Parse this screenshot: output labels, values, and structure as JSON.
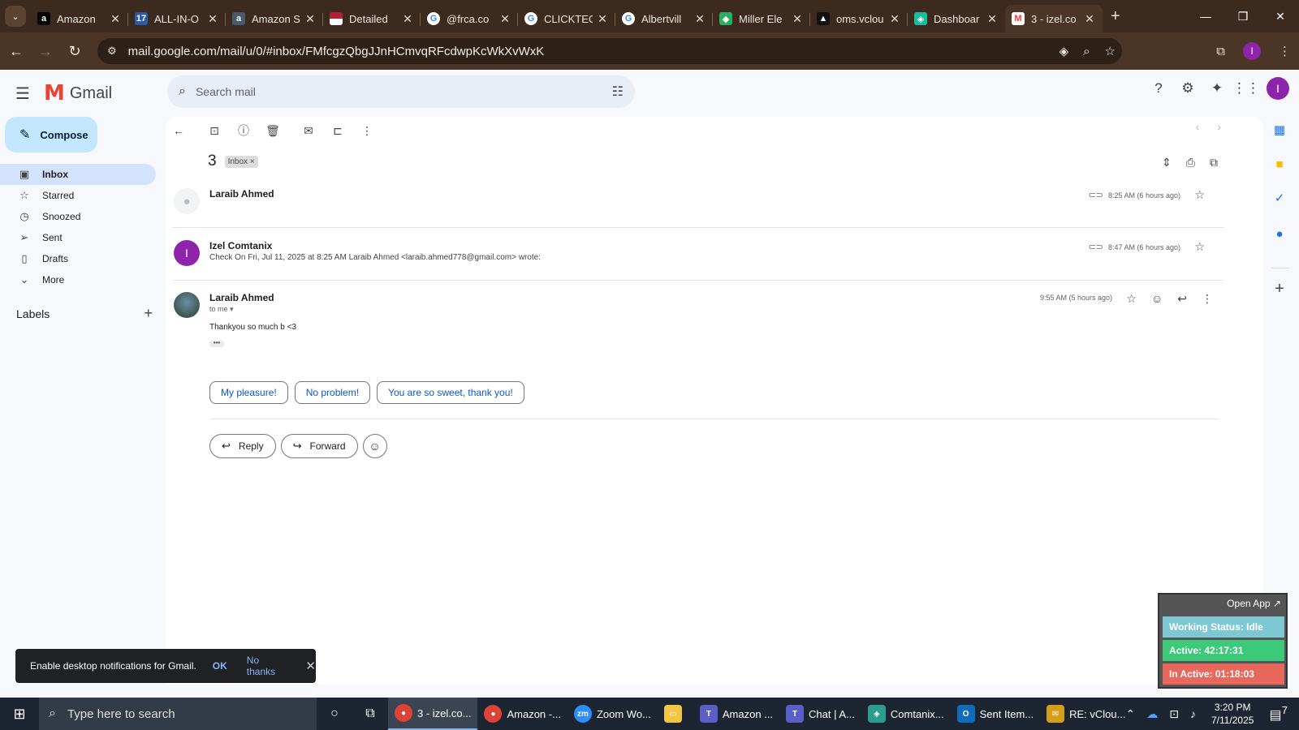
{
  "browser": {
    "tabs": [
      {
        "title": "Amazon",
        "icon": "amazon-icon",
        "color": "#000000"
      },
      {
        "title": "ALL-IN-O",
        "icon": "seventeen-track-icon",
        "color": "#2b5aa8"
      },
      {
        "title": "Amazon S",
        "icon": "amazon-seller-icon",
        "color": "#232f3e"
      },
      {
        "title": "Detailed",
        "icon": "flag-icon",
        "color": "#b22234"
      },
      {
        "title": "@frca.co",
        "icon": "google-icon",
        "color": "#4285f4"
      },
      {
        "title": "CLICKTEC",
        "icon": "google-icon",
        "color": "#4285f4"
      },
      {
        "title": "Albertvill",
        "icon": "google-icon",
        "color": "#4285f4"
      },
      {
        "title": "Miller Ele",
        "icon": "miller-icon",
        "color": "#27ae60"
      },
      {
        "title": "oms.vclou",
        "icon": "oms-icon",
        "color": "#111111"
      },
      {
        "title": "Dashboar",
        "icon": "dashboard-icon",
        "color": "#1abc9c"
      },
      {
        "title": "3 - izel.co",
        "icon": "gmail-icon",
        "color": "#ea4335"
      }
    ],
    "url": "mail.google.com/mail/u/0/#inbox/FMfcgzQbgJJnHCmvqRFcdwpKcWkXvWxK",
    "profile_initial": "I"
  },
  "gmail": {
    "app_name": "Gmail",
    "search_placeholder": "Search mail",
    "compose_label": "Compose",
    "nav": [
      {
        "label": "Inbox",
        "icon": "inbox-icon"
      },
      {
        "label": "Starred",
        "icon": "star-icon"
      },
      {
        "label": "Snoozed",
        "icon": "clock-icon"
      },
      {
        "label": "Sent",
        "icon": "send-icon"
      },
      {
        "label": "Drafts",
        "icon": "draft-icon"
      },
      {
        "label": "More",
        "icon": "chevron-down-icon"
      }
    ],
    "labels_title": "Labels",
    "avatar_initial": "I"
  },
  "thread": {
    "subject": "3",
    "label_chip": "Inbox",
    "label_chip_close": "×",
    "messages": [
      {
        "sender": "Laraib Ahmed",
        "time": "8:25 AM (6 hours ago)",
        "snippet": ""
      },
      {
        "sender": "Izel Comtanix",
        "time": "8:47 AM (6 hours ago)",
        "snippet": "Check On Fri, Jul 11, 2025 at 8:25 AM Laraib Ahmed <laraib.ahmed778@gmail.com> wrote:",
        "avatar_initial": "I"
      },
      {
        "sender": "Laraib Ahmed",
        "time": "9:55 AM (5 hours ago)",
        "to": "to me",
        "body": "Thankyou so much b <3"
      }
    ],
    "smart_replies": [
      "My pleasure!",
      "No problem!",
      "You are so sweet, thank you!"
    ],
    "reply_label": "Reply",
    "forward_label": "Forward"
  },
  "toast": {
    "message": "Enable desktop notifications for Gmail.",
    "ok": "OK",
    "no_thanks": "No thanks"
  },
  "widget": {
    "open_app": "Open App ↗",
    "working_status": "Working Status: Idle",
    "active": "Active: 42:17:31",
    "inactive": "In Active: 01:18:03",
    "colors": {
      "status": "#7ec8d3",
      "active": "#3cc97a",
      "inactive": "#e8685e"
    }
  },
  "taskbar": {
    "search_placeholder": "Type here to search",
    "apps": [
      {
        "label": "3 - izel.co...",
        "icon": "chrome-icon",
        "active": true
      },
      {
        "label": "Amazon -...",
        "icon": "chrome-icon"
      },
      {
        "label": "Zoom Wo...",
        "icon": "zoom-icon"
      },
      {
        "label": "",
        "icon": "file-explorer-icon"
      },
      {
        "label": "Amazon ...",
        "icon": "teams-icon"
      },
      {
        "label": "Chat | A...",
        "icon": "teams-icon"
      },
      {
        "label": "Comtanix...",
        "icon": "comtanix-icon"
      },
      {
        "label": "Sent Item...",
        "icon": "outlook-icon"
      },
      {
        "label": "RE: vClou...",
        "icon": "mail-icon"
      }
    ],
    "time": "3:20 PM",
    "date": "7/11/2025",
    "notification_count": "7"
  }
}
